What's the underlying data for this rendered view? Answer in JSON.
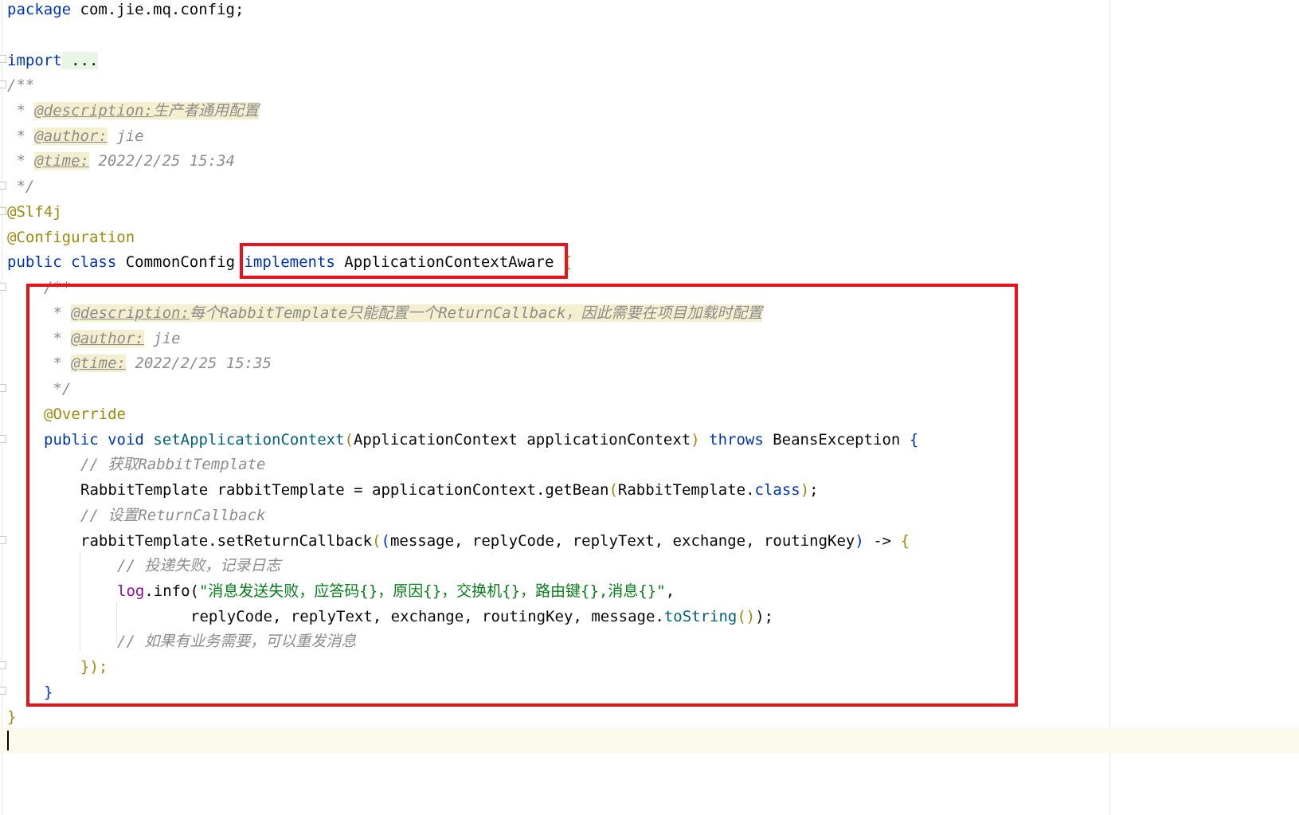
{
  "code": {
    "package_kw": "package",
    "package_name": " com.jie.mq.config;",
    "import_kw": "import",
    "import_fold": " ...",
    "doc_open": "/**",
    "doc1_star": " * ",
    "doc1_tag": "@description:",
    "doc1_text": "生产者通用配置",
    "doc2_tag": "@author:",
    "doc2_text": " jie",
    "doc3_tag": "@time:",
    "doc3_text": " 2022/2/25 15:34",
    "doc_close": " */",
    "ann_slf4j": "@Slf4j",
    "ann_config": "@Configuration",
    "class_public": "public",
    "class_kw": "class",
    "class_name": " CommonConfig ",
    "implements_kw": "implements",
    "implements_type": " ApplicationContextAware ",
    "class_open": "{",
    "m_doc_open": "/**",
    "m_doc1_tag": "@description:",
    "m_doc1_text": "每个RabbitTemplate只能配置一个ReturnCallback，因此需要在项目加载时配置",
    "m_doc2_tag": "@author:",
    "m_doc2_text": " jie",
    "m_doc3_tag": "@time:",
    "m_doc3_text": " 2022/2/25 15:35",
    "m_doc_close": " */",
    "ann_override": "@Override",
    "m_public": "public",
    "m_void": "void",
    "m_name": "setApplicationContext",
    "m_params": "ApplicationContext applicationContext",
    "m_throws": "throws",
    "m_exc": " BeansException ",
    "m_open": "{",
    "c1": "// 获取RabbitTemplate",
    "l1_a": "RabbitTemplate rabbitTemplate = applicationContext.getBean",
    "l1_b": "RabbitTemplate.",
    "l1_class": "class",
    "l1_end": ";",
    "c2": "// 设置ReturnCallback",
    "l2_a": "rabbitTemplate.setReturnCallback",
    "l2_params": "message, replyCode, replyText, exchange, routingKey",
    "l2_arrow": " -> ",
    "l2_open": "{",
    "c3": "// 投递失败，记录日志",
    "l3_log": "log",
    "l3_info": ".info(",
    "l3_str": "\"消息发送失败，应答码{}，原因{}，交换机{}，路由键{},消息{}\"",
    "l3_end": ",",
    "l4_a": "replyCode, replyText, exchange, routingKey, message.",
    "l4_fn": "toString",
    "l4_end": ");",
    "c4": "// 如果有业务需要，可以重发消息",
    "l5": "});",
    "m_close": "}",
    "class_close": "}"
  },
  "colors": {
    "keyword": "#0033b3",
    "annotation": "#9e880d",
    "comment": "#8c8c8c",
    "function": "#00627a",
    "string": "#067d17",
    "field": "#871094",
    "highlight_box": "#e8131a"
  }
}
